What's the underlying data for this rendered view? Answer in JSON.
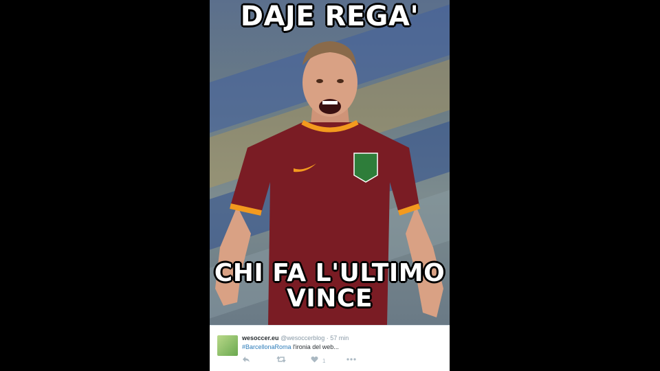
{
  "meme": {
    "top_caption": "DAJE REGA'",
    "bottom_caption": "CHI FA L'ULTIMO VINCE"
  },
  "tweet": {
    "display_name": "wesoccer.eu",
    "handle": "@wesoccerblog",
    "separator": "·",
    "time": "57 min",
    "hashtag": "#BarcellonaRoma",
    "text": "l'ironia del web...",
    "like_count": "1"
  },
  "icons": {
    "reply": "reply-icon",
    "retweet": "retweet-icon",
    "like": "heart-icon",
    "more": "more-icon"
  },
  "colors": {
    "background": "#000000",
    "jersey": "#7a1c24",
    "trim": "#f39a1e",
    "link": "#2b7bb9",
    "muted": "#8899a6"
  }
}
